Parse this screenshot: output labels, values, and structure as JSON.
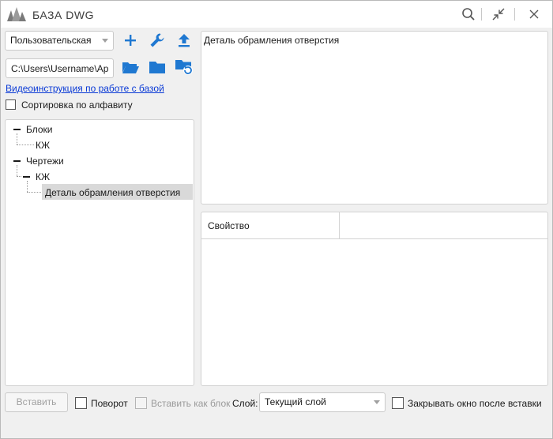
{
  "window": {
    "title": "БАЗА DWG"
  },
  "toolbar": {
    "category_combo": "Пользовательская",
    "path_value": "C:\\Users\\Username\\AppData"
  },
  "links": {
    "video_instruction": "Видеоинструкция по работе с базой"
  },
  "options": {
    "sort_alpha_label": "Сортировка по алфавиту",
    "sort_alpha_checked": false
  },
  "tree": {
    "blocks": {
      "label": "Блоки",
      "children": [
        {
          "label": "КЖ"
        }
      ]
    },
    "drawings": {
      "label": "Чертежи",
      "children": [
        {
          "label": "КЖ",
          "children": [
            {
              "label": "Деталь обрамления отверстия"
            }
          ]
        }
      ]
    }
  },
  "preview": {
    "caption": "Деталь обрамления отверстия"
  },
  "properties": {
    "columns": [
      "Свойство",
      ""
    ]
  },
  "footer": {
    "insert_button": "Вставить",
    "rotate_label": "Поворот",
    "insert_as_block_label": "Вставить как блок",
    "layer_label": "Слой:",
    "layer_value": "Текущий слой",
    "close_after_insert_label": "Закрывать окно после вставки"
  },
  "colors": {
    "accent": "#1f78d1",
    "selection": "#d9d9d9",
    "link": "#0a3ad6"
  }
}
